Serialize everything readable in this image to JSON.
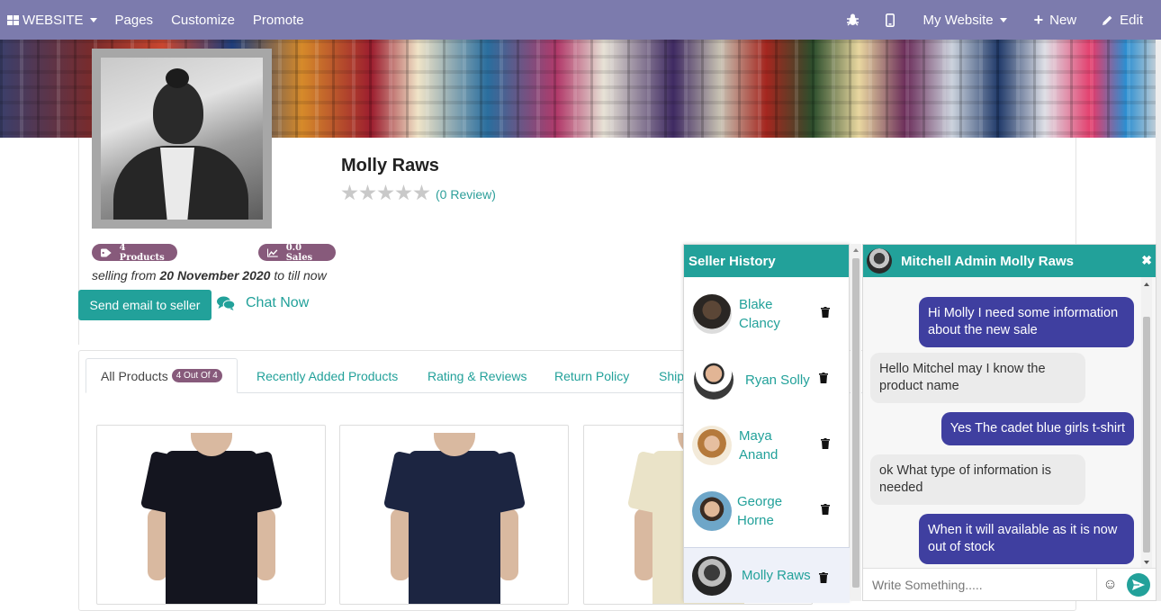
{
  "topbar": {
    "website_label": "WEBSITE",
    "pages_label": "Pages",
    "customize_label": "Customize",
    "promote_label": "Promote",
    "my_website_label": "My Website",
    "new_label": "New",
    "edit_label": "Edit",
    "bg_color": "#7c7bad"
  },
  "seller": {
    "name": "Molly Raws",
    "rating": 0,
    "review_label": "(0 Review)",
    "products_badge": "4  Products",
    "sales_badge": "0.0  Sales",
    "selling_prefix": "selling from",
    "selling_date": "20 November 2020",
    "selling_suffix": "to till now",
    "email_button": "Send email to seller",
    "chat_button": "Chat Now"
  },
  "tabs": [
    {
      "label": "All Products",
      "count": "4 Out Of 4",
      "active": true
    },
    {
      "label": "Recently Added Products"
    },
    {
      "label": "Rating & Reviews"
    },
    {
      "label": "Return Policy"
    },
    {
      "label": "Ship"
    }
  ],
  "products": [
    {
      "color": "#14151f",
      "icon": "black-tshirt"
    },
    {
      "color": "#1c2541",
      "icon": "navy-tshirt"
    },
    {
      "color": "#eae3c8",
      "icon": "cream-tshirt"
    }
  ],
  "seller_history": {
    "title": "Seller History",
    "items": [
      {
        "name": "Blake Clancy",
        "active": false
      },
      {
        "name": "Ryan Solly",
        "active": false
      },
      {
        "name": "Maya Anand",
        "active": false
      },
      {
        "name": "George Horne",
        "active": false
      },
      {
        "name": "Molly Raws",
        "active": true
      }
    ]
  },
  "chat": {
    "title": "Mitchell Admin Molly Raws",
    "messages": [
      {
        "dir": "out",
        "text": "Hi Molly I need some information about the new sale"
      },
      {
        "dir": "in",
        "text": "Hello Mitchel may I know the product name"
      },
      {
        "dir": "out",
        "text": "Yes The cadet blue girls t-shirt"
      },
      {
        "dir": "in",
        "text": "ok What type of information is needed"
      },
      {
        "dir": "out",
        "text": "When it will available as it is now out of stock"
      }
    ],
    "input_placeholder": "Write Something.....",
    "accent_color": "#22a19a",
    "outgoing_color": "#3f3fa0"
  }
}
